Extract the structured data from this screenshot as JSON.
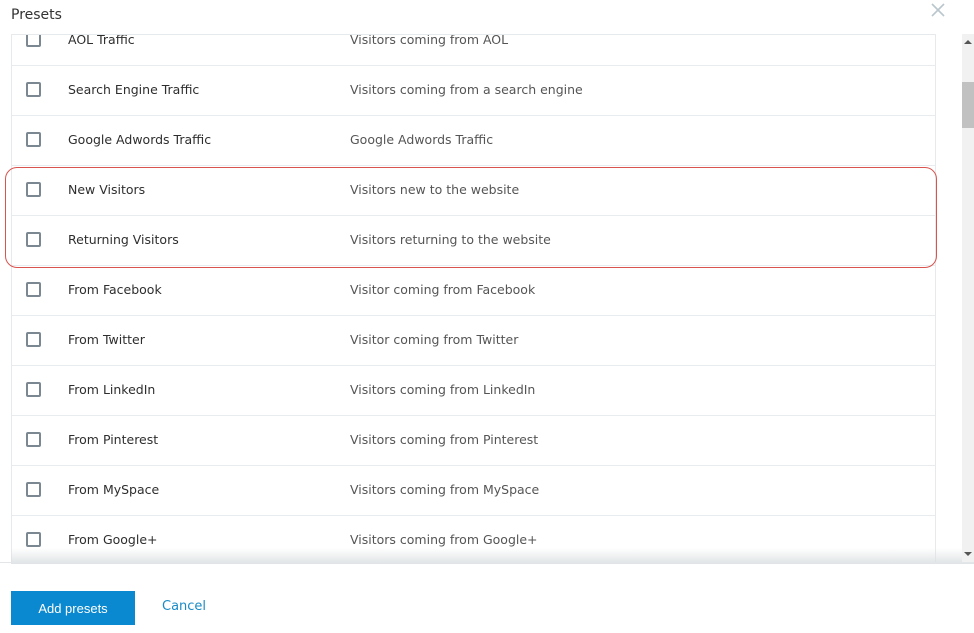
{
  "dialog": {
    "title": "Presets",
    "close_label": "×"
  },
  "presets": [
    {
      "name": "AOL Traffic",
      "description": "Visitors coming from AOL",
      "checked": false
    },
    {
      "name": "Search Engine Traffic",
      "description": "Visitors coming from a search engine",
      "checked": false
    },
    {
      "name": "Google Adwords Traffic",
      "description": "Google Adwords Traffic",
      "checked": false
    },
    {
      "name": "New Visitors",
      "description": "Visitors new to the website",
      "checked": false
    },
    {
      "name": "Returning Visitors",
      "description": "Visitors returning to the website",
      "checked": false
    },
    {
      "name": "From Facebook",
      "description": "Visitor coming from Facebook",
      "checked": false
    },
    {
      "name": "From Twitter",
      "description": "Visitor coming from Twitter",
      "checked": false
    },
    {
      "name": "From LinkedIn",
      "description": "Visitors coming from LinkedIn",
      "checked": false
    },
    {
      "name": "From Pinterest",
      "description": "Visitors coming from Pinterest",
      "checked": false
    },
    {
      "name": "From MySpace",
      "description": "Visitors coming from MySpace",
      "checked": false
    },
    {
      "name": "From Google+",
      "description": "Visitors coming from Google+",
      "checked": false
    }
  ],
  "footer": {
    "add_label": "Add presets",
    "cancel_label": "Cancel"
  },
  "colors": {
    "primary": "#0a88d0",
    "link": "#1a8bc6",
    "highlight": "#d9534f"
  }
}
